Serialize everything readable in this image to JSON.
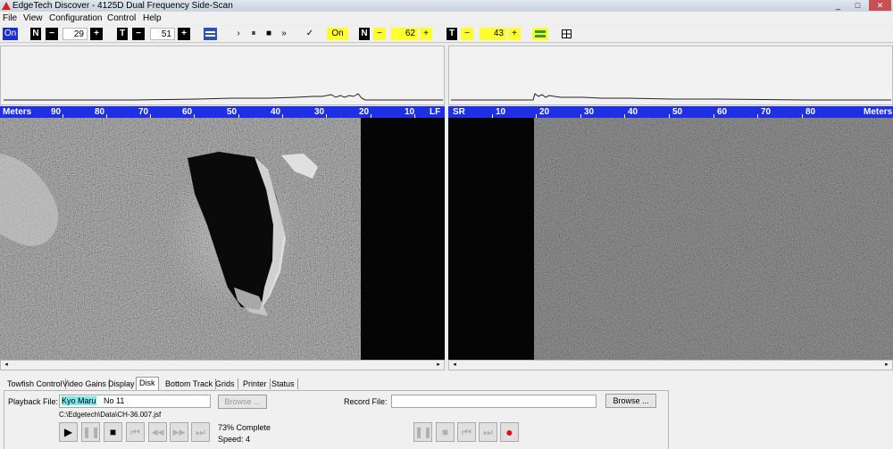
{
  "window": {
    "title": "EdgeTech  Discover - 4125D  Dual Frequency Side-Scan",
    "controls": [
      "_",
      "□",
      "✕"
    ]
  },
  "menu": [
    "File",
    "View",
    "Configuration",
    "Control",
    "Help"
  ],
  "toolbar": {
    "left": {
      "on": "On",
      "n_label": "N",
      "n_value": "29",
      "t_label": "T",
      "t_value": "51"
    },
    "playback": [
      "›",
      "⏸",
      "■",
      "»"
    ],
    "check": "✓",
    "right": {
      "on": "On",
      "n_label": "N",
      "n_value": "62",
      "t_label": "T",
      "t_value": "43"
    },
    "minus": "−",
    "plus": "+"
  },
  "ruler_left": {
    "label": "Meters",
    "ticks": [
      "90",
      "80",
      "70",
      "60",
      "50",
      "40",
      "30",
      "20",
      "10"
    ],
    "end": "LF"
  },
  "ruler_right": {
    "start": "SR",
    "ticks": [
      "10",
      "20",
      "30",
      "40",
      "50",
      "60",
      "70",
      "80"
    ],
    "label": "Meters"
  },
  "scroll": {
    "left": "◂",
    "right": "▸"
  },
  "tabs": [
    "Towfish Control",
    "Video Gains",
    "Display",
    "Disk",
    "Bottom Track",
    "Grids",
    "Printer",
    "Status"
  ],
  "disk": {
    "playback_label": "Playback File:",
    "playback_highlight": "Kyo Maru",
    "playback_rest": " No 11",
    "playback_path": "C:\\Edgetech\\Data\\CH-36.007.jsf",
    "browse": "Browse ...",
    "record_label": "Record File:",
    "record_browse": "Browse ...",
    "progress": "73% Complete",
    "speed": "Speed: 4",
    "play_controls": [
      "▶",
      "❚❚",
      "■",
      "⏮",
      "◀◀",
      "▶▶",
      "⏭"
    ],
    "record_controls": [
      "❚❚",
      "■",
      "⏮",
      "⏭",
      "●"
    ]
  },
  "colors": {
    "ruler": "#1e2fe6",
    "highlight": "#ffff2a",
    "record": "#e01010"
  }
}
